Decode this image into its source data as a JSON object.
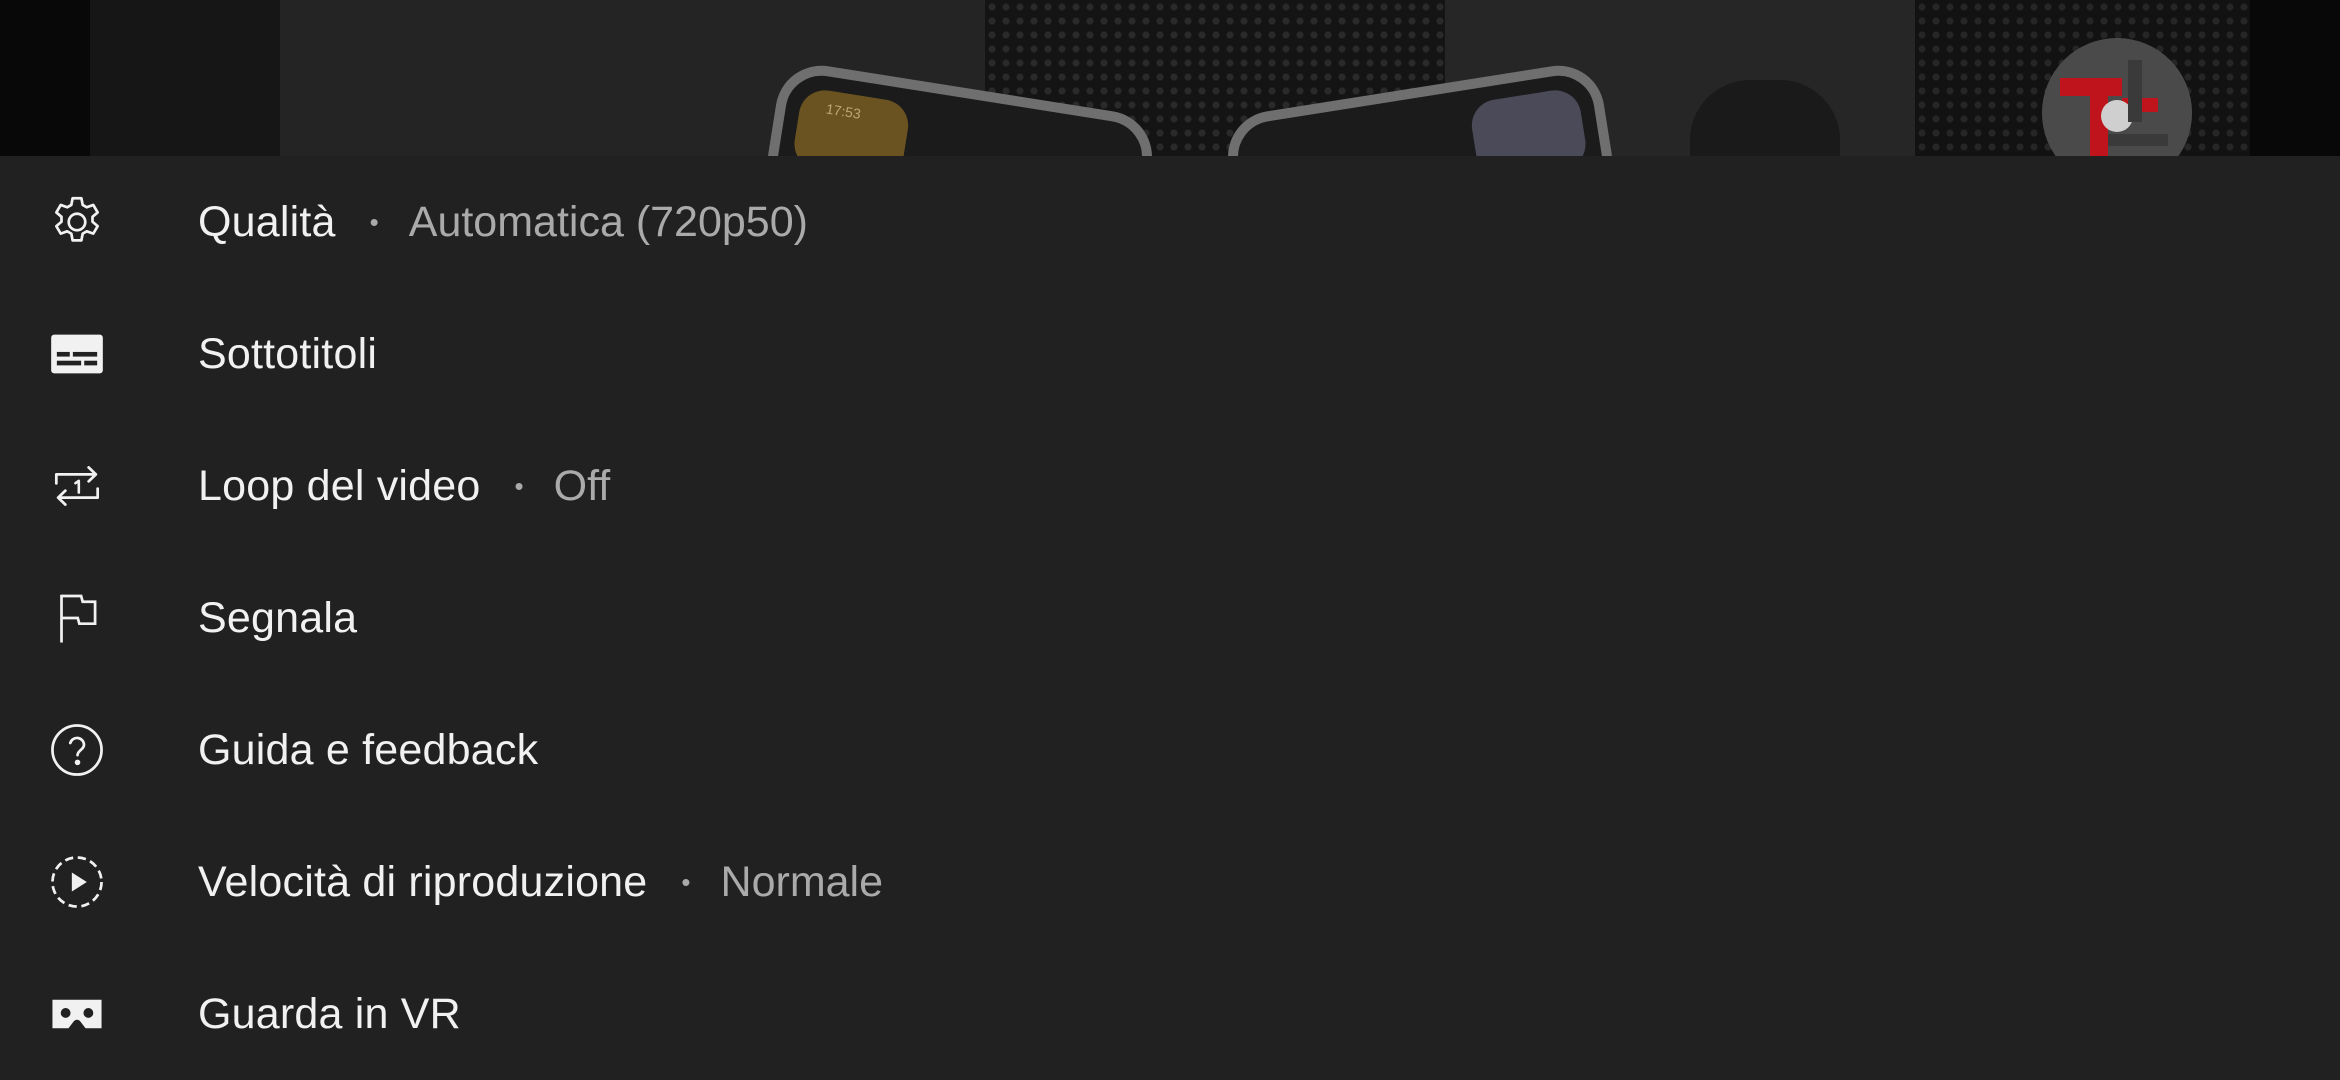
{
  "video": {
    "phone_clock": "17:53"
  },
  "menu": {
    "items": [
      {
        "icon": "gear-icon",
        "label": "Qualità",
        "separator": "•",
        "value": "Automatica (720p50)"
      },
      {
        "icon": "subtitles-icon",
        "label": "Sottotitoli"
      },
      {
        "icon": "loop-one-icon",
        "label": "Loop del video",
        "separator": "•",
        "value": "Off"
      },
      {
        "icon": "flag-icon",
        "label": "Segnala"
      },
      {
        "icon": "help-circle-icon",
        "label": "Guida e feedback"
      },
      {
        "icon": "playback-speed-icon",
        "label": "Velocità di riproduzione",
        "separator": "•",
        "value": "Normale"
      },
      {
        "icon": "cardboard-vr-icon",
        "label": "Guarda in VR"
      }
    ]
  },
  "colors": {
    "sheet_background": "#212121",
    "primary_text": "#f1f1f1",
    "secondary_text": "#aaaaaa",
    "logo_red": "#c0141c"
  }
}
